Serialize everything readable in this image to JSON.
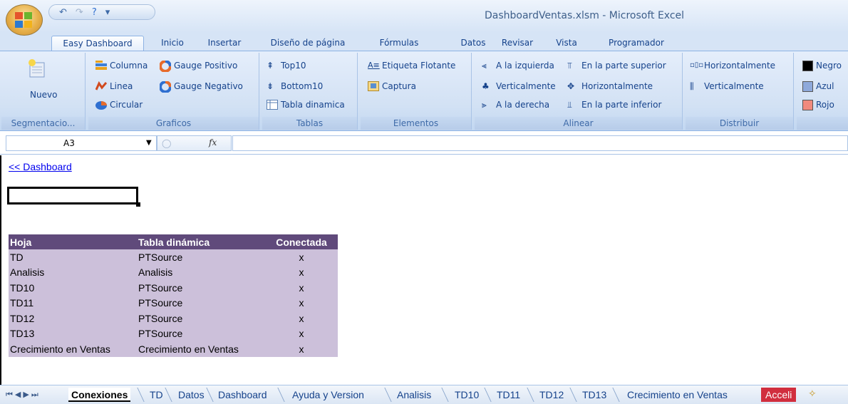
{
  "window": {
    "title": "DashboardVentas.xlsm - Microsoft Excel"
  },
  "tabs": [
    "Easy Dashboard",
    "Inicio",
    "Insertar",
    "Diseño de página",
    "Fórmulas",
    "Datos",
    "Revisar",
    "Vista",
    "Programador"
  ],
  "ribbon": {
    "segmentacion": {
      "button": "Nuevo",
      "label": "Segmentacio..."
    },
    "graficos": {
      "label": "Graficos",
      "columna": "Columna",
      "linea": "Linea",
      "circular": "Circular",
      "gauge_pos": "Gauge Positivo",
      "gauge_neg": "Gauge Negativo"
    },
    "tablas": {
      "label": "Tablas",
      "top10": "Top10",
      "bottom10": "Bottom10",
      "tabla_dinamica": "Tabla dinamica"
    },
    "elementos": {
      "label": "Elementos",
      "etiqueta": "Etiqueta Flotante",
      "captura": "Captura"
    },
    "alinear": {
      "label": "Alinear",
      "izquierda": "A la izquierda",
      "verticalmente": "Verticalmente",
      "derecha": "A la derecha",
      "superior": "En la parte superior",
      "horizontalmente": "Horizontalmente",
      "inferior": "En la parte inferior"
    },
    "distribuir": {
      "label": "Distribuir",
      "horizontalmente": "Horizontalmente",
      "verticalmente": "Verticalmente"
    },
    "colores": {
      "negro": "Negro",
      "azul": "Azul",
      "rojo": "Rojo"
    }
  },
  "formula_bar": {
    "name_box": "A3",
    "fx": "fx"
  },
  "sheet": {
    "link": "<< Dashboard",
    "table": {
      "headers": [
        "Hoja",
        "Tabla dinámica",
        "Conectada"
      ],
      "rows": [
        [
          "TD",
          "PTSource",
          "x"
        ],
        [
          "Analisis",
          "Analisis",
          "x"
        ],
        [
          "TD10",
          "PTSource",
          "x"
        ],
        [
          "TD11",
          "PTSource",
          "x"
        ],
        [
          "TD12",
          "PTSource",
          "x"
        ],
        [
          "TD13",
          "PTSource",
          "x"
        ],
        [
          "Crecimiento en Ventas",
          "Crecimiento en Ventas",
          "x"
        ]
      ]
    }
  },
  "sheet_tabs": [
    "Conexiones",
    "TD",
    "Datos",
    "Dashboard",
    "Ayuda y Version",
    "Analisis",
    "TD10",
    "TD11",
    "TD12",
    "TD13",
    "Crecimiento en Ventas",
    "Acceli"
  ],
  "colors": {
    "header_bg": "#604a7b",
    "row_bg": "#ccc0da",
    "red_tab": "#d12e3e"
  }
}
